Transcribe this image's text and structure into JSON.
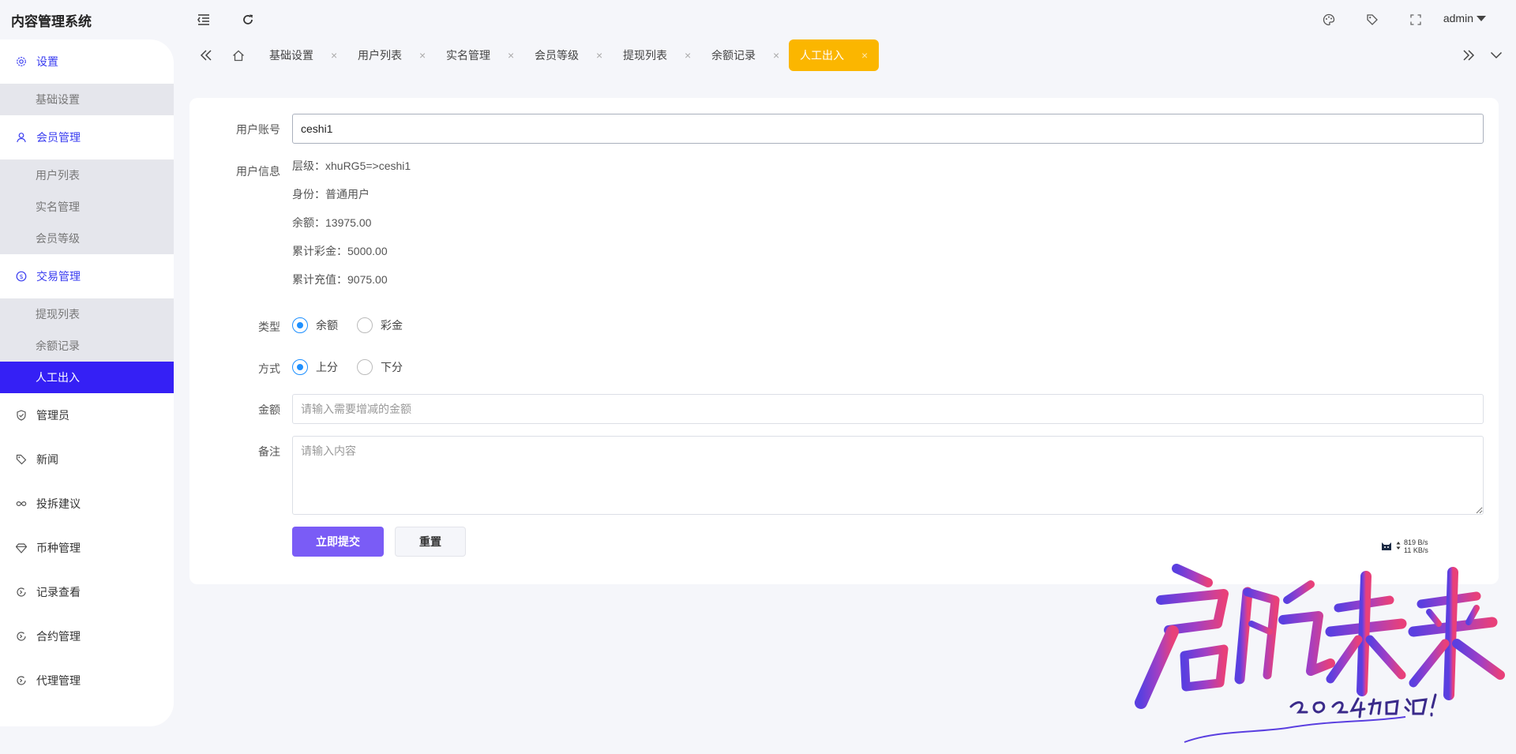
{
  "header": {
    "app_title": "内容管理系统",
    "user": "admin",
    "icons": [
      "menu-fold-icon",
      "refresh-icon",
      "palette-icon",
      "tag-icon",
      "fullscreen-icon"
    ]
  },
  "sidebar": {
    "groups": [
      {
        "label": "设置",
        "icon": "gear-icon",
        "items": [
          "基础设置"
        ]
      },
      {
        "label": "会员管理",
        "icon": "user-icon",
        "items": [
          "用户列表",
          "实名管理",
          "会员等级"
        ]
      },
      {
        "label": "交易管理",
        "icon": "dollar-icon",
        "items": [
          "提现列表",
          "余额记录",
          "人工出入"
        ]
      },
      {
        "label": "管理员",
        "icon": "shield-icon"
      },
      {
        "label": "新闻",
        "icon": "tag-icon"
      },
      {
        "label": "投拆建议",
        "icon": "infinity-icon"
      },
      {
        "label": "币种管理",
        "icon": "diamond-icon"
      },
      {
        "label": "记录查看",
        "icon": "circle-arrow-icon"
      },
      {
        "label": "合约管理",
        "icon": "circle-arrow-icon"
      },
      {
        "label": "代理管理",
        "icon": "circle-arrow-icon"
      }
    ],
    "current_item": "人工出入"
  },
  "tabs": {
    "items": [
      "基础设置",
      "用户列表",
      "实名管理",
      "会员等级",
      "提现列表",
      "余额记录",
      "人工出入"
    ],
    "active": "人工出入",
    "close_glyph": "×"
  },
  "form": {
    "account_label": "用户账号",
    "account_value": "ceshi1",
    "info_label": "用户信息",
    "info_lines": [
      "层级：xhuRG5=>ceshi1",
      "身份：普通用户",
      "余额：13975.00",
      "累计彩金：5000.00",
      "累计充值：9075.00"
    ],
    "type_label": "类型",
    "type_options": [
      "余额",
      "彩金"
    ],
    "type_selected": "余额",
    "mode_label": "方式",
    "mode_options": [
      "上分",
      "下分"
    ],
    "mode_selected": "上分",
    "amount_label": "金额",
    "amount_placeholder": "请输入需要增减的金额",
    "remark_label": "备注",
    "remark_placeholder": "请输入内容",
    "submit_label": "立即提交",
    "reset_label": "重置"
  },
  "netspeed": {
    "up": "819 B/s",
    "down": "11 KB/s"
  },
  "watermark": {
    "main": "启航未来",
    "sub": "2024加油!"
  },
  "colors": {
    "accent": "#3520f5",
    "active_tab": "#fbb600",
    "primary_button": "#7a5cf6",
    "radio": "#1e90ff"
  }
}
